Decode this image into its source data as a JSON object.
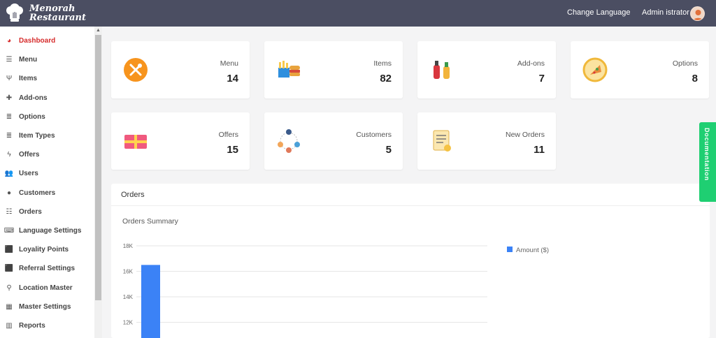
{
  "app": {
    "brand_line1": "Menorah",
    "brand_line2": "Restaurant"
  },
  "topbar": {
    "change_language": "Change Language",
    "user_name": "Admin istrator"
  },
  "sidebar": {
    "items": [
      {
        "label": "Dashboard",
        "icon": "dashboard-icon",
        "active": true
      },
      {
        "label": "Menu",
        "icon": "bars-icon"
      },
      {
        "label": "Items",
        "icon": "utensils-icon"
      },
      {
        "label": "Add-ons",
        "icon": "plus-icon"
      },
      {
        "label": "Options",
        "icon": "list-icon"
      },
      {
        "label": "Item Types",
        "icon": "list-icon"
      },
      {
        "label": "Offers",
        "icon": "bolt-icon"
      },
      {
        "label": "Users",
        "icon": "users-icon"
      },
      {
        "label": "Customers",
        "icon": "user-icon"
      },
      {
        "label": "Orders",
        "icon": "list-ul-icon"
      },
      {
        "label": "Language Settings",
        "icon": "language-icon"
      },
      {
        "label": "Loyality Points",
        "icon": "gift-icon"
      },
      {
        "label": "Referral Settings",
        "icon": "gift-icon"
      },
      {
        "label": "Location Master",
        "icon": "map-pin-icon"
      },
      {
        "label": "Master Settings",
        "icon": "grid-icon"
      },
      {
        "label": "Reports",
        "icon": "bar-chart-icon"
      }
    ]
  },
  "cards": [
    {
      "label": "Menu",
      "value": "14",
      "icon": "menu-plate-icon"
    },
    {
      "label": "Items",
      "value": "82",
      "icon": "fast-food-icon"
    },
    {
      "label": "Add-ons",
      "value": "7",
      "icon": "sauce-bottles-icon"
    },
    {
      "label": "Options",
      "value": "8",
      "icon": "pizza-icon"
    },
    {
      "label": "Offers",
      "value": "15",
      "icon": "gift-card-icon"
    },
    {
      "label": "Customers",
      "value": "5",
      "icon": "people-network-icon"
    },
    {
      "label": "New Orders",
      "value": "11",
      "icon": "order-list-icon"
    }
  ],
  "orders_panel": {
    "title": "Orders",
    "subtitle": "Orders Summary"
  },
  "documentation_tab": "Documentation",
  "colors": {
    "topbar": "#4b4e62",
    "active": "#d62b2b",
    "bar": "#3b82f6",
    "doc_tab": "#1fcf72"
  },
  "chart_data": {
    "type": "bar",
    "series": [
      {
        "name": "Amount ($)",
        "values": [
          16500
        ]
      }
    ],
    "yticks": [
      "18K",
      "16K",
      "14K",
      "12K"
    ],
    "ylim_visible": [
      11000,
      18000
    ],
    "legend_position": "top-right",
    "grid": true
  }
}
